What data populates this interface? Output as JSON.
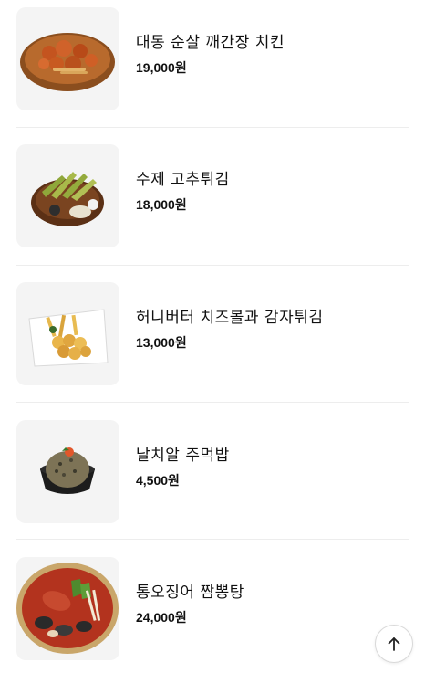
{
  "menu": {
    "items": [
      {
        "name": "대동 순살 깨간장 치킨",
        "price": "19,000원",
        "image_icon": "soy-garlic-boneless-chicken-image"
      },
      {
        "name": "수제 고추튀김",
        "price": "18,000원",
        "image_icon": "fried-pepper-image"
      },
      {
        "name": "허니버터 치즈볼과 감자튀김",
        "price": "13,000원",
        "image_icon": "honey-butter-cheeseball-fries-image"
      },
      {
        "name": "날치알 주먹밥",
        "price": "4,500원",
        "image_icon": "flying-fish-roe-riceball-image"
      },
      {
        "name": "통오징어 짬뽕탕",
        "price": "24,000원",
        "image_icon": "whole-squid-jjamppong-soup-image"
      }
    ]
  },
  "scroll_top": {
    "icon": "arrow-up-icon"
  }
}
